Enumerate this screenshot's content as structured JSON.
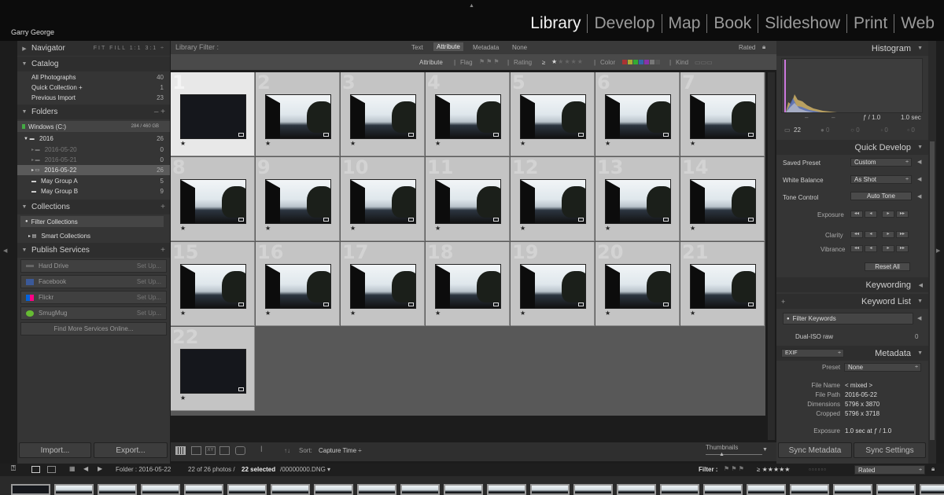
{
  "app": {
    "user": "Garry George"
  },
  "modules": [
    "Library",
    "Develop",
    "Map",
    "Book",
    "Slideshow",
    "Print",
    "Web"
  ],
  "left": {
    "navigator": {
      "title": "Navigator",
      "zoom": [
        "FIT",
        "FILL",
        "1:1",
        "3:1"
      ]
    },
    "catalog": {
      "title": "Catalog",
      "items": [
        {
          "label": "All Photographs",
          "count": "40"
        },
        {
          "label": "Quick Collection +",
          "count": "1"
        },
        {
          "label": "Previous Import",
          "count": "23"
        }
      ]
    },
    "folders": {
      "title": "Folders",
      "volume": "Windows (C:)",
      "volume_info": "284 / 460 GB",
      "items": [
        {
          "label": "2016",
          "count": "26"
        },
        {
          "label": "2016-05-20",
          "count": "0"
        },
        {
          "label": "2016-05-21",
          "count": "0"
        },
        {
          "label": "2016-05-22",
          "count": "26"
        },
        {
          "label": "May Group A",
          "count": "5"
        },
        {
          "label": "May Group B",
          "count": "9"
        }
      ]
    },
    "collections": {
      "title": "Collections",
      "items": [
        "Filter Collections",
        "Smart Collections"
      ]
    },
    "publish": {
      "title": "Publish Services",
      "items": [
        {
          "label": "Hard Drive",
          "action": "Set Up..."
        },
        {
          "label": "Facebook",
          "action": "Set Up..."
        },
        {
          "label": "Flickr",
          "action": "Set Up..."
        },
        {
          "label": "SmugMug",
          "action": "Set Up..."
        }
      ],
      "more": "Find More Services Online..."
    },
    "import_label": "Import...",
    "export_label": "Export..."
  },
  "filter": {
    "title": "Library Filter :",
    "tabs": [
      "Text",
      "Attribute",
      "Metadata",
      "None"
    ],
    "active_tab": "Attribute",
    "rated": "Rated",
    "attr": {
      "label": "Attribute",
      "flag": "Flag",
      "rating": "Rating",
      "rating_op": "≥",
      "color": "Color",
      "kind": "Kind"
    }
  },
  "grid": {
    "cells": [
      {
        "n": "1",
        "dark": true,
        "selected": true
      },
      {
        "n": "2"
      },
      {
        "n": "3"
      },
      {
        "n": "4"
      },
      {
        "n": "5"
      },
      {
        "n": "6"
      },
      {
        "n": "7"
      },
      {
        "n": "8"
      },
      {
        "n": "9"
      },
      {
        "n": "10"
      },
      {
        "n": "11"
      },
      {
        "n": "12"
      },
      {
        "n": "13"
      },
      {
        "n": "14"
      },
      {
        "n": "15"
      },
      {
        "n": "16"
      },
      {
        "n": "17"
      },
      {
        "n": "18"
      },
      {
        "n": "19"
      },
      {
        "n": "20"
      },
      {
        "n": "21"
      },
      {
        "n": "22",
        "dark": true
      }
    ],
    "star": "★"
  },
  "toolbar": {
    "sort_label": "Sort:",
    "sort_value": "Capture Time ÷",
    "thumbnails": "Thumbnails"
  },
  "right": {
    "histogram": {
      "title": "Histogram",
      "aperture": "ƒ / 1.0",
      "shutter": "1.0 sec",
      "count": "22",
      "dashes": [
        "–",
        "–"
      ]
    },
    "quick_develop": {
      "title": "Quick Develop",
      "saved_preset": {
        "label": "Saved Preset",
        "value": "Custom"
      },
      "white_balance": {
        "label": "White Balance",
        "value": "As Shot"
      },
      "tone_control": {
        "label": "Tone Control",
        "auto": "Auto Tone"
      },
      "exposure": "Exposure",
      "clarity": "Clarity",
      "vibrance": "Vibrance",
      "reset": "Reset All"
    },
    "keywording": "Keywording",
    "keyword_list": {
      "title": "Keyword List",
      "filter": "Filter Keywords",
      "items": [
        {
          "label": "Dual-ISO raw",
          "count": "0"
        }
      ]
    },
    "metadata": {
      "title": "Metadata",
      "set": "EXIF",
      "preset_label": "Preset",
      "preset_value": "None",
      "fields": [
        {
          "label": "File Name",
          "value": "< mixed >"
        },
        {
          "label": "File Path",
          "value": "2016-05-22"
        },
        {
          "label": "Dimensions",
          "value": "5796 x 3870"
        },
        {
          "label": "Cropped",
          "value": "5796 x 3718"
        },
        {
          "label": "Exposure",
          "value": "1.0 sec at ƒ / 1.0"
        }
      ]
    },
    "sync_metadata": "Sync Metadata",
    "sync_settings": "Sync Settings"
  },
  "status": {
    "folder": "Folder : 2016-05-22",
    "photos": "22 of 26 photos /",
    "selected": "22 selected",
    "file": "/00000000.DNG ▾",
    "filter_label": "Filter :",
    "rating": "≥ ★★★★★",
    "rated": "Rated"
  },
  "colors": {
    "accent": "#f2f2f2",
    "selected_cell": "#e8e8e8",
    "cell": "#c4c4c4",
    "panel": "#353535"
  }
}
